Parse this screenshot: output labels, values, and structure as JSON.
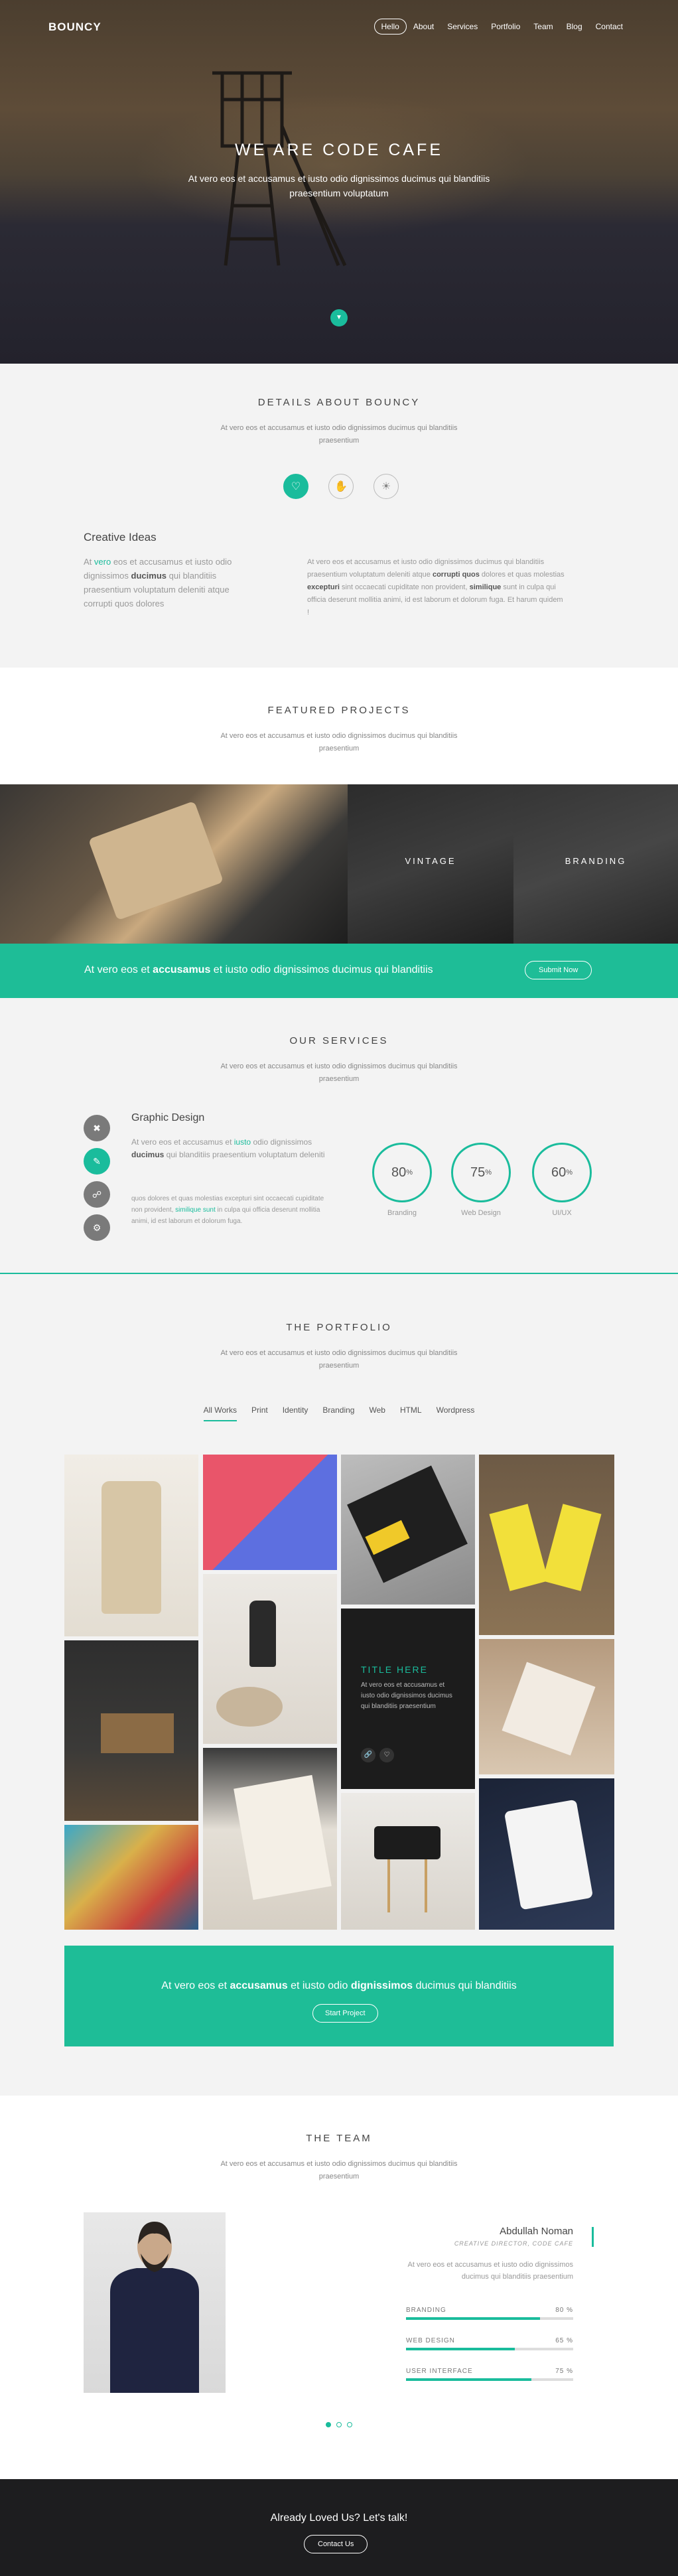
{
  "hero": {
    "brand": "BOUNCY",
    "nav": [
      "Hello",
      "About",
      "Services",
      "Portfolio",
      "Team",
      "Blog",
      "Contact"
    ],
    "headline": "WE ARE CODE CAFE",
    "tagline": "At vero eos et accusamus et iusto odio dignissimos ducimus qui blanditiis praesentium voluptatum"
  },
  "details": {
    "title": "DETAILS ABOUT BOUNCY",
    "subtitle": "At vero eos et accusamus et iusto odio dignissimos ducimus qui blanditiis praesentium",
    "icons": [
      "heart-icon",
      "hand-icon",
      "bulb-icon"
    ],
    "creative_title": "Creative Ideas",
    "creative_p1": "At ",
    "creative_hl": "vero",
    "creative_p2": " eos et accusamus et iusto odio dignissimos ",
    "creative_bold": "ducimus",
    "creative_p3": " qui blanditiis praesentium voluptatum deleniti atque corrupti quos dolores",
    "right_p1": "At vero eos et accusamus et iusto odio dignissimos ducimus qui blanditiis praesentium voluptatum deleniti atque ",
    "right_b1": "corrupti quos",
    "right_p2": " dolores et quas molestias ",
    "right_b2": "excepturi",
    "right_p3": " sint occaecati cupiditate non provident, ",
    "right_b3": "similique",
    "right_p4": " sunt in culpa qui officia deserunt mollitia animi, id est laborum et dolorum fuga. Et harum quidem !"
  },
  "featured": {
    "title": "FEATURED PROJECTS",
    "subtitle": "At vero eos et accusamus et iusto odio dignissimos ducimus qui blanditiis praesentium",
    "projects": [
      "",
      "VINTAGE",
      "BRANDING"
    ]
  },
  "cta1": {
    "text_a": "At vero eos et ",
    "text_b": "accusamus",
    "text_c": " et iusto odio dignissimos ducimus qui blanditiis",
    "button": "Submit Now"
  },
  "services": {
    "title": "OUR SERVICES",
    "subtitle": "At vero eos et accusamus et iusto odio dignissimos ducimus qui blanditiis praesentium",
    "graphic_title": "Graphic Design",
    "graphic_p1": "At vero eos et accusamus et ",
    "graphic_hl": "iusto",
    "graphic_p2": " odio dignissimos ",
    "graphic_bold": "ducimus",
    "graphic_p3": " qui blanditiis praesentium voluptatum deleniti",
    "graphic_d1": "quos dolores et quas molestias excepturi sint occaecati cupiditate non provident, ",
    "graphic_dhl": "similique sunt",
    "graphic_d2": " in culpa qui officia deserunt mollitia animi, id est laborum et dolorum fuga.",
    "stats": [
      {
        "value": "80",
        "unit": "%",
        "label": "Branding"
      },
      {
        "value": "75",
        "unit": "%",
        "label": "Web Design"
      },
      {
        "value": "60",
        "unit": "%",
        "label": "UI/UX"
      }
    ]
  },
  "portfolio": {
    "title": "THE PORTFOLIO",
    "subtitle": "At vero eos et accusamus et iusto odio dignissimos ducimus qui blanditiis praesentium",
    "filters": [
      "All Works",
      "Print",
      "Identity",
      "Branding",
      "Web",
      "HTML",
      "Wordpress"
    ],
    "overlay_title": "TITLE HERE",
    "overlay_text": "At vero eos et accusamus et iusto odio dignissimos ducimus qui blanditiis praesentium",
    "banner_a": "At vero eos et ",
    "banner_b": "accusamus",
    "banner_c": " et iusto odio ",
    "banner_d": "dignissimos",
    "banner_e": " ducimus qui blanditiis",
    "banner_button": "Start Project"
  },
  "team": {
    "title": "THE TEAM",
    "subtitle": "At vero eos et accusamus et iusto odio dignissimos ducimus qui blanditiis praesentium",
    "name": "Abdullah Noman",
    "role": "CREATIVE DIRECTOR, CODE CAFE",
    "desc": "At vero eos et accusamus et iusto odio dignissimos ducimus qui blanditiis praesentium",
    "skills": [
      {
        "label": "BRANDING",
        "value": "80 %",
        "pct": 80
      },
      {
        "label": "WEB DESIGN",
        "value": "65 %",
        "pct": 65
      },
      {
        "label": "USER INTERFACE",
        "value": "75 %",
        "pct": 75
      }
    ]
  },
  "footer": {
    "text": "Already Loved Us? Let's talk!",
    "button": "Contact Us"
  },
  "colors": {
    "accent": "#1abc9c"
  }
}
